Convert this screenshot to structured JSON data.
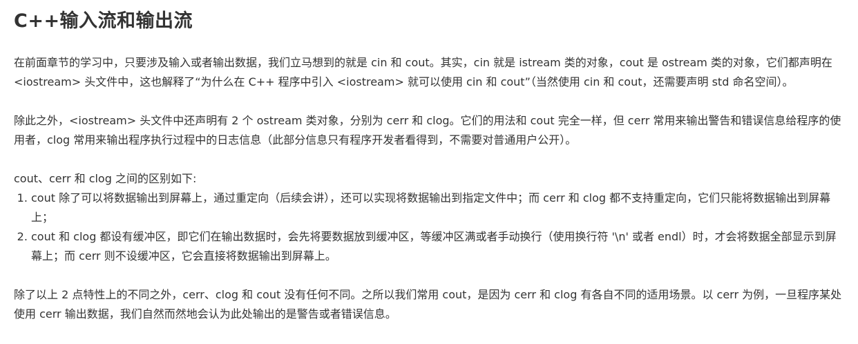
{
  "title": "C++输入流和输出流",
  "paragraphs": {
    "p1": "在前面章节的学习中，只要涉及输入或者输出数据，我们立马想到的就是 cin 和 cout。其实，cin 就是 istream 类的对象，cout 是 ostream 类的对象，它们都声明在 <iostream> 头文件中，这也解释了“为什么在 C++ 程序中引入 <iostream> 就可以使用 cin 和 cout”（当然使用 cin 和 cout，还需要声明 std 命名空间）。",
    "p2": "除此之外，<iostream> 头文件中还声明有 2 个 ostream 类对象，分别为 cerr 和 clog。它们的用法和 cout 完全一样，但 cerr 常用来输出警告和错误信息给程序的使用者，clog 常用来输出程序执行过程中的日志信息（此部分信息只有程序开发者看得到，不需要对普通用户公开）。",
    "p3": "cout、cerr 和 clog 之间的区别如下:",
    "p4": "除了以上 2 点特性上的不同之外，cerr、clog 和 cout 没有任何不同。之所以我们常用 cout，是因为 cerr 和 clog 有各自不同的适用场景。以 cerr 为例，一旦程序某处使用 cerr 输出数据，我们自然而然地会认为此处输出的是警告或者错误信息。"
  },
  "list": [
    "cout 除了可以将数据输出到屏幕上，通过重定向（后续会讲），还可以实现将数据输出到指定文件中；而 cerr 和 clog 都不支持重定向，它们只能将数据输出到屏幕上；",
    "cout 和 clog 都设有缓冲区，即它们在输出数据时，会先将要数据放到缓冲区，等缓冲区满或者手动换行（使用换行符 '\\n' 或者 endl）时，才会将数据全部显示到屏幕上；而 cerr 则不设缓冲区，它会直接将数据输出到屏幕上。"
  ]
}
